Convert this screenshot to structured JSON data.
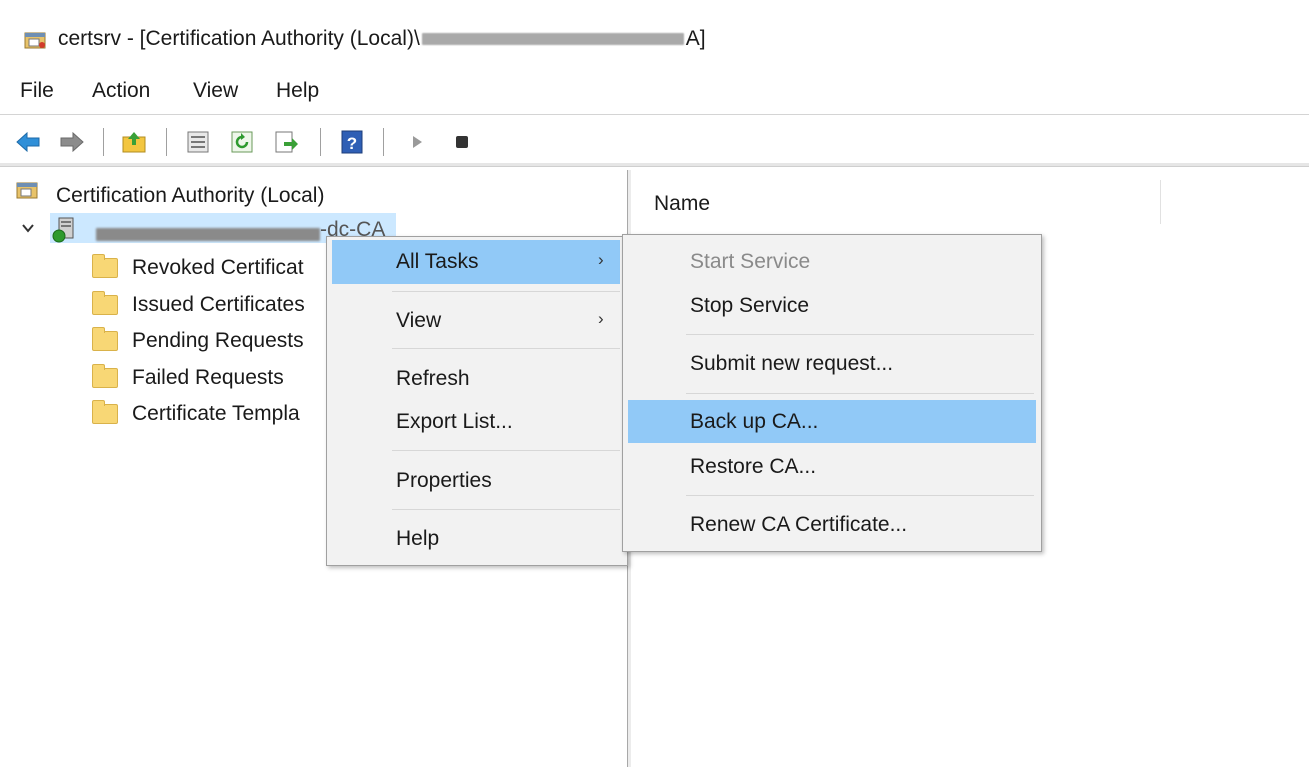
{
  "window": {
    "title_prefix": "certsrv - [Certification Authority (Local)\\",
    "title_suffix": "A]"
  },
  "menubar": {
    "items": [
      "File",
      "Action",
      "View",
      "Help"
    ]
  },
  "toolbar": {
    "icons": [
      "back-arrow-icon",
      "forward-arrow-icon",
      "up-folder-icon",
      "show-hide-tree-icon",
      "refresh-icon",
      "export-list-icon",
      "help-icon",
      "start-service-icon",
      "stop-service-icon"
    ]
  },
  "tree": {
    "root_label": "Certification Authority (Local)",
    "ca_node_suffix": "-dc-CA",
    "children": [
      "Revoked Certificat",
      "Issued Certificates",
      "Pending Requests",
      "Failed Requests",
      "Certificate Templa"
    ]
  },
  "list": {
    "column_name": "Name"
  },
  "context_menu": {
    "items": {
      "all_tasks": "All Tasks",
      "view": "View",
      "refresh": "Refresh",
      "export_list": "Export List...",
      "properties": "Properties",
      "help": "Help"
    },
    "submenu_arrow": "›"
  },
  "all_tasks_submenu": {
    "start_service": "Start Service",
    "stop_service": "Stop Service",
    "submit_request": "Submit new request...",
    "back_up_ca": "Back up CA...",
    "restore_ca": "Restore CA...",
    "renew_ca_cert": "Renew CA Certificate..."
  },
  "colors": {
    "highlight": "#91c9f7",
    "tree_selection": "#cce8ff",
    "folder": "#f8d775",
    "menu_bg": "#f2f2f2"
  }
}
